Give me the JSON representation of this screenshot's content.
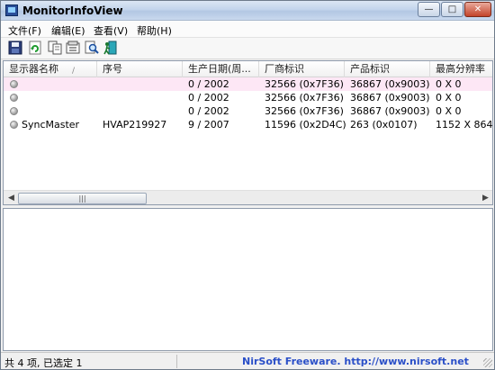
{
  "window": {
    "title": "MonitorInfoView",
    "minimize_glyph": "—",
    "maximize_glyph": "□",
    "close_glyph": "✕"
  },
  "menu": [
    {
      "label": "文件(F)"
    },
    {
      "label": "编辑(E)"
    },
    {
      "label": "查看(V)"
    },
    {
      "label": "帮助(H)"
    }
  ],
  "toolbar": {
    "icons": [
      "save-icon",
      "refresh-icon",
      "copy-icon",
      "properties-icon",
      "find-icon",
      "exit-icon"
    ]
  },
  "columns": [
    "显示器名称",
    "序号",
    "生产日期(周...",
    "厂商标识",
    "产品标识",
    "最高分辨率"
  ],
  "sort_indicator": "/",
  "rows": [
    {
      "name": "",
      "serial": "",
      "date": "0 / 2002",
      "vendor": "32566 (0x7F36)",
      "product": "36867 (0x9003)",
      "resolution": "0 X 0",
      "selected": true
    },
    {
      "name": "",
      "serial": "",
      "date": "0 / 2002",
      "vendor": "32566 (0x7F36)",
      "product": "36867 (0x9003)",
      "resolution": "0 X 0",
      "selected": false
    },
    {
      "name": "",
      "serial": "",
      "date": "0 / 2002",
      "vendor": "32566 (0x7F36)",
      "product": "36867 (0x9003)",
      "resolution": "0 X 0",
      "selected": false
    },
    {
      "name": "SyncMaster",
      "serial": "HVAP219927",
      "date": "9 / 2007",
      "vendor": "11596 (0x2D4C)",
      "product": "263 (0x0107)",
      "resolution": "1152 X 864",
      "selected": false
    }
  ],
  "scrollbar": {
    "left_arrow": "◀",
    "right_arrow": "▶",
    "thumb_grip": "|||"
  },
  "status": {
    "summary": "共 4 项, 已选定 1",
    "link": "NirSoft Freeware.  http://www.nirsoft.net"
  },
  "colors": {
    "selected_row": "#fde7f5",
    "link": "#2a4fc8",
    "title_bar": "#c3d5ec",
    "close_button": "#c3432a"
  }
}
